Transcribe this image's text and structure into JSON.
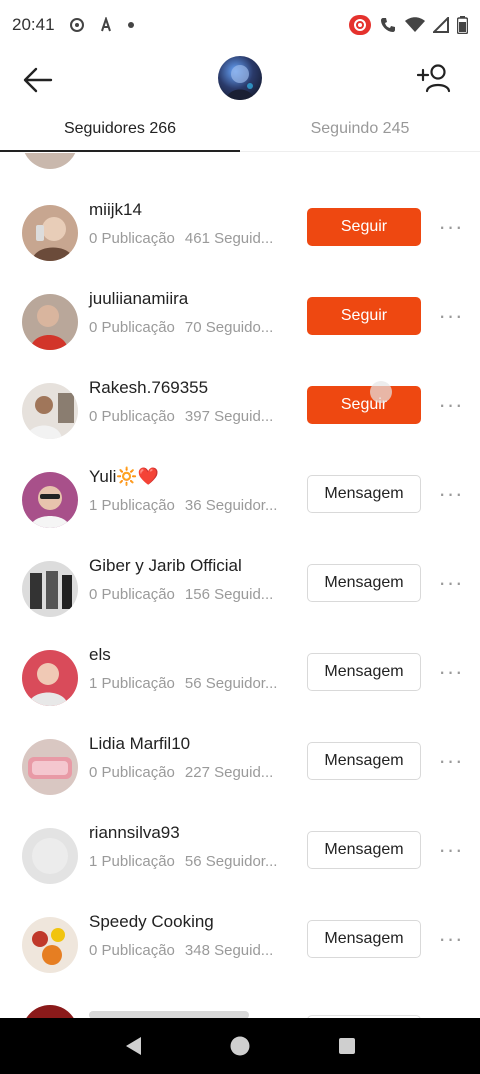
{
  "status_bar": {
    "time": "20:41",
    "icons": [
      "circle-icon",
      "a-icon",
      "dot-icon",
      "record-icon",
      "call-icon",
      "wifi-icon",
      "signal-icon",
      "battery-icon"
    ],
    "record_color": "#e5322d"
  },
  "header": {
    "back_icon": "arrow-left-icon",
    "add_user_icon": "add-user-icon"
  },
  "tabs": [
    {
      "label": "Seguidores 266",
      "active": true
    },
    {
      "label": "Seguindo 245",
      "active": false
    }
  ],
  "accent_color": "#ee4811",
  "rows": [
    {
      "name": "miijk14",
      "posts": "0 Publicação",
      "followers": "461 Seguid...",
      "button": "Seguir",
      "type": "follow"
    },
    {
      "name": "juuliianamiira",
      "posts": "0 Publicação",
      "followers": "70 Seguido...",
      "button": "Seguir",
      "type": "follow"
    },
    {
      "name": "Rakesh.769355",
      "posts": "0 Publicação",
      "followers": "397 Seguid...",
      "button": "Seguir",
      "type": "follow"
    },
    {
      "name": "Yuli🔆❤️",
      "posts": "1 Publicação",
      "followers": "36 Seguidor...",
      "button": "Mensagem",
      "type": "message"
    },
    {
      "name": "Giber y Jarib Official",
      "posts": "0 Publicação",
      "followers": "156 Seguid...",
      "button": "Mensagem",
      "type": "message"
    },
    {
      "name": "els",
      "posts": "1 Publicação",
      "followers": "56 Seguidor...",
      "button": "Mensagem",
      "type": "message"
    },
    {
      "name": "Lidia Marfil10",
      "posts": "0 Publicação",
      "followers": "227 Seguid...",
      "button": "Mensagem",
      "type": "message"
    },
    {
      "name": "riannsilva93",
      "posts": "1 Publicação",
      "followers": "56 Seguidor...",
      "button": "Mensagem",
      "type": "message"
    },
    {
      "name": "Speedy Cooking",
      "posts": "0 Publicação",
      "followers": "348 Seguid...",
      "button": "Mensagem",
      "type": "message"
    }
  ],
  "more_label": "···"
}
